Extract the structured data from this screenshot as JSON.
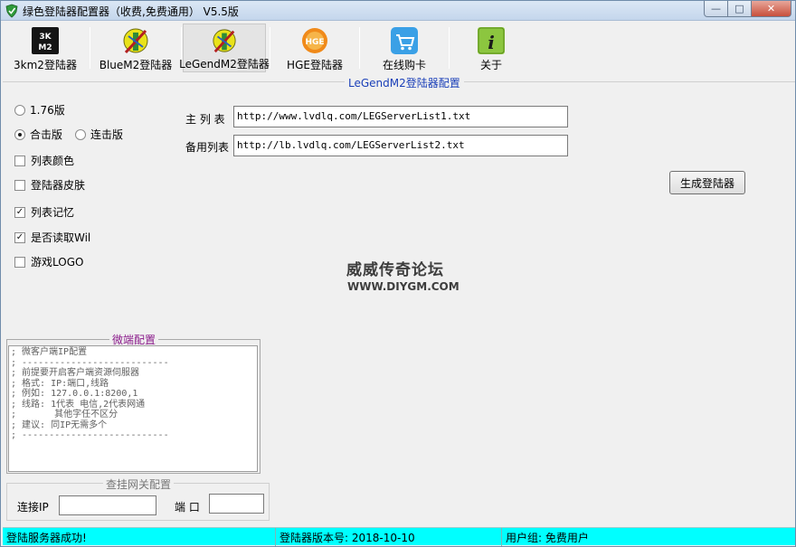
{
  "window": {
    "title": "绿色登陆器配置器（收费,免费通用）  V5.5版",
    "minimize": "—",
    "maximize": "□",
    "close": "✕"
  },
  "toolbar": [
    {
      "label": "3km2登陆器",
      "icon": "3km2-icon"
    },
    {
      "label": "BlueM2登陆器",
      "icon": "bluem2-icon"
    },
    {
      "label": "LeGendM2登陆器",
      "icon": "legendm2-icon"
    },
    {
      "label": "HGE登陆器",
      "icon": "hge-icon"
    },
    {
      "label": "在线购卡",
      "icon": "cart-icon"
    },
    {
      "label": "关于",
      "icon": "info-icon"
    }
  ],
  "icon_text": {
    "top": "3K",
    "bottom": "M2",
    "hge": "HGE",
    "info": "i"
  },
  "group_title": "LeGendM2登陆器配置",
  "options": {
    "v176": "1.76版",
    "combined": "合击版",
    "chained": "连击版",
    "list_color": "列表颜色",
    "skin": "登陆器皮肤",
    "list_memory": "列表记忆",
    "read_wil": "是否读取Wil",
    "game_logo": "游戏LOGO"
  },
  "checks": {
    "on": "✓",
    "off": ""
  },
  "fields": {
    "main_label": "主 列 表",
    "main_value": "http://www.lvdlq.com/LEGServerList1.txt",
    "backup_label": "备用列表",
    "backup_value": "http://lb.lvdlq.com/LEGServerList2.txt"
  },
  "generate_button": "生成登陆器",
  "watermark": {
    "title": "威威传奇论坛",
    "url": "WWW.DIYGM.COM"
  },
  "micro": {
    "title": "微端配置",
    "lines": [
      "; 微客户端IP配置",
      "; ---------------------------",
      "; 前提要开启客户端资源伺服器",
      "; 格式: IP:端口,线路",
      "; 例如: 127.0.0.1:8200,1",
      "; 线路: 1代表 电信,2代表网通",
      ";       其他字任不区分",
      "; 建议: 同IP无需多个",
      "; ---------------------------"
    ]
  },
  "gateway": {
    "title": "查挂网关配置",
    "connect_label": "连接IP",
    "connect_value": "",
    "port_label": "端 口",
    "port_value": ""
  },
  "status": {
    "message": "登陆服务器成功!",
    "version": "登陆器版本号: 2018-10-10",
    "usergroup": "用户组: 免费用户"
  }
}
